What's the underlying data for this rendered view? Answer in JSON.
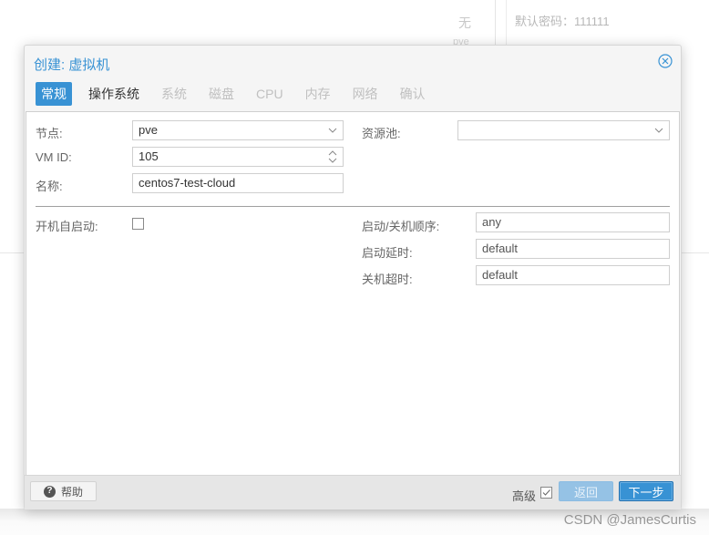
{
  "background": {
    "value_none": "无",
    "value_pve": "pve",
    "default_password": "默认密码：111111"
  },
  "watermark": "CSDN @JamesCurtis",
  "dialog": {
    "title": "创建: 虚拟机",
    "close_icon": "close-circle-icon",
    "tabs": [
      {
        "label": "常规",
        "state": "active"
      },
      {
        "label": "操作系统",
        "state": "enabled"
      },
      {
        "label": "系统",
        "state": "disabled"
      },
      {
        "label": "磁盘",
        "state": "disabled"
      },
      {
        "label": "CPU",
        "state": "disabled"
      },
      {
        "label": "内存",
        "state": "disabled"
      },
      {
        "label": "网络",
        "state": "disabled"
      },
      {
        "label": "确认",
        "state": "disabled"
      }
    ],
    "form": {
      "node": {
        "label": "节点:",
        "value": "pve"
      },
      "vmid": {
        "label": "VM ID:",
        "value": "105"
      },
      "name": {
        "label": "名称:",
        "value": "centos7-test-cloud"
      },
      "pool": {
        "label": "资源池:",
        "value": ""
      },
      "onboot": {
        "label": "开机自启动:",
        "checked": false
      },
      "startup_order": {
        "label": "启动/关机顺序:",
        "value": "any"
      },
      "startup_delay": {
        "label": "启动延时:",
        "value": "default"
      },
      "shutdown_timeout": {
        "label": "关机超时:",
        "value": "default"
      }
    },
    "footer": {
      "help_label": "帮助",
      "advanced_label": "高级",
      "advanced_checked": true,
      "back_label": "返回",
      "next_label": "下一步"
    },
    "colors": {
      "accent": "#3892d4",
      "accent_disabled": "#95c2e5"
    }
  }
}
